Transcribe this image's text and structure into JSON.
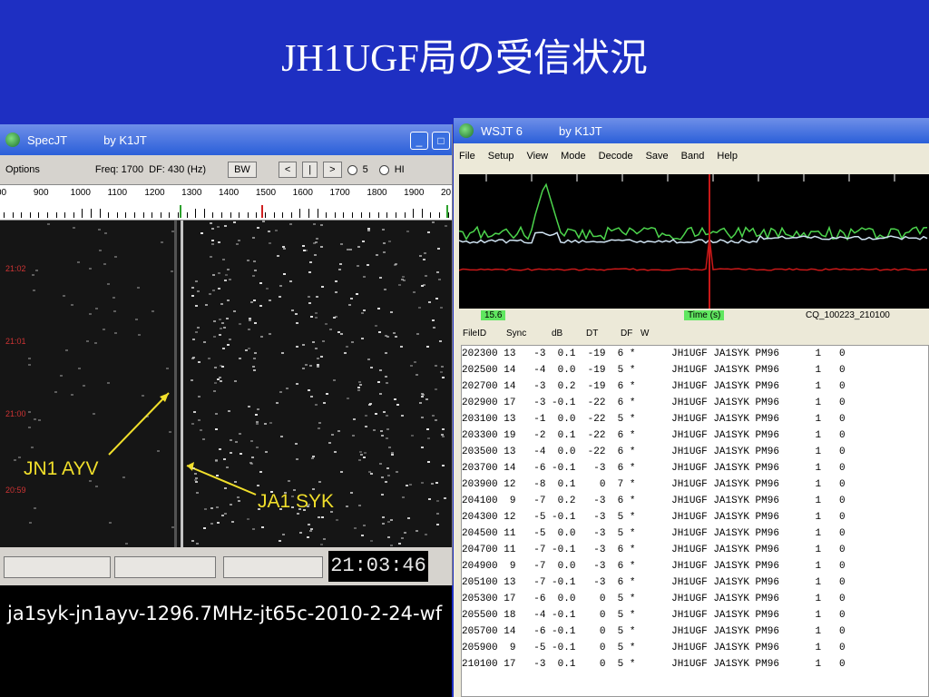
{
  "slide": {
    "title": "JH1UGF局の受信状況"
  },
  "specjt": {
    "title": "SpecJT",
    "by": "by K1JT",
    "toolbar": {
      "options": "Options",
      "freq": "Freq: 1700",
      "df": "DF: 430 (Hz)",
      "bw": "BW",
      "prev": "<",
      "mid": "|",
      "next": ">",
      "opt5": "5",
      "opthi": "HI"
    },
    "scale_labels": [
      "00",
      "900",
      "1000",
      "1100",
      "1200",
      "1300",
      "1400",
      "1500",
      "1600",
      "1700",
      "1800",
      "1900",
      "20"
    ],
    "time_labels": [
      "21:02",
      "21:01",
      "21:00",
      "20:59"
    ],
    "callsign_1": "JN1 AYV",
    "callsign_2": "JA1 SYK",
    "clock": "21:03:46"
  },
  "caption": {
    "text": "ja1syk-jn1ayv-1296.7MHz-jt65c-2010-2-24-wf"
  },
  "wsjt": {
    "title": "WSJT 6",
    "by": "by K1JT",
    "menu": [
      "File",
      "Setup",
      "View",
      "Mode",
      "Decode",
      "Save",
      "Band",
      "Help"
    ],
    "plot_label_left": "15.6",
    "plot_label_mid": "Time (s)",
    "plot_label_right": "CQ_100223_210100",
    "columns": [
      "FileID",
      "Sync",
      "dB",
      "DT",
      "DF",
      "W"
    ],
    "rows": [
      [
        "202300",
        "13",
        "-3",
        "0.1",
        "-19",
        "6",
        "*",
        "JH1UGF JA1SYK PM96",
        "1",
        "0"
      ],
      [
        "202500",
        "14",
        "-4",
        "0.0",
        "-19",
        "5",
        "*",
        "JH1UGF JA1SYK PM96",
        "1",
        "0"
      ],
      [
        "202700",
        "14",
        "-3",
        "0.2",
        "-19",
        "6",
        "*",
        "JH1UGF JA1SYK PM96",
        "1",
        "0"
      ],
      [
        "202900",
        "17",
        "-3",
        "-0.1",
        "-22",
        "6",
        "*",
        "JH1UGF JA1SYK PM96",
        "1",
        "0"
      ],
      [
        "203100",
        "13",
        "-1",
        "0.0",
        "-22",
        "5",
        "*",
        "JH1UGF JA1SYK PM96",
        "1",
        "0"
      ],
      [
        "203300",
        "19",
        "-2",
        "0.1",
        "-22",
        "6",
        "*",
        "JH1UGF JA1SYK PM96",
        "1",
        "0"
      ],
      [
        "203500",
        "13",
        "-4",
        "0.0",
        "-22",
        "6",
        "*",
        "JH1UGF JA1SYK PM96",
        "1",
        "0"
      ],
      [
        "203700",
        "14",
        "-6",
        "-0.1",
        "-3",
        "6",
        "*",
        "JH1UGF JA1SYK PM96",
        "1",
        "0"
      ],
      [
        "203900",
        "12",
        "-8",
        "0.1",
        "0",
        "7",
        "*",
        "JH1UGF JA1SYK PM96",
        "1",
        "0"
      ],
      [
        "204100",
        "9",
        "-7",
        "0.2",
        "-3",
        "6",
        "*",
        "JH1UGF JA1SYK PM96",
        "1",
        "0"
      ],
      [
        "204300",
        "12",
        "-5",
        "-0.1",
        "-3",
        "5",
        "*",
        "JH1UGF JA1SYK PM96",
        "1",
        "0"
      ],
      [
        "204500",
        "11",
        "-5",
        "0.0",
        "-3",
        "5",
        "*",
        "JH1UGF JA1SYK PM96",
        "1",
        "0"
      ],
      [
        "204700",
        "11",
        "-7",
        "-0.1",
        "-3",
        "6",
        "*",
        "JH1UGF JA1SYK PM96",
        "1",
        "0"
      ],
      [
        "204900",
        "9",
        "-7",
        "0.0",
        "-3",
        "6",
        "*",
        "JH1UGF JA1SYK PM96",
        "1",
        "0"
      ],
      [
        "205100",
        "13",
        "-7",
        "-0.1",
        "-3",
        "6",
        "*",
        "JH1UGF JA1SYK PM96",
        "1",
        "0"
      ],
      [
        "205300",
        "17",
        "-6",
        "0.0",
        "0",
        "5",
        "*",
        "JH1UGF JA1SYK PM96",
        "1",
        "0"
      ],
      [
        "205500",
        "18",
        "-4",
        "-0.1",
        "0",
        "5",
        "*",
        "JH1UGF JA1SYK PM96",
        "1",
        "0"
      ],
      [
        "205700",
        "14",
        "-6",
        "-0.1",
        "0",
        "5",
        "*",
        "JH1UGF JA1SYK PM96",
        "1",
        "0"
      ],
      [
        "205900",
        "9",
        "-5",
        "-0.1",
        "0",
        "5",
        "*",
        "JH1UGF JA1SYK PM96",
        "1",
        "0"
      ],
      [
        "210100",
        "17",
        "-3",
        "0.1",
        "0",
        "5",
        "*",
        "JH1UGF JA1SYK PM96",
        "1",
        "0"
      ]
    ]
  },
  "colors": {
    "slide_bg": "#1e2fc2",
    "callout": "#f1df2b",
    "spectrum_green": "#4cd44c",
    "spectrum_white": "#cfe3f2",
    "spectrum_red": "#c81818",
    "label_green": "#5fe65f"
  }
}
